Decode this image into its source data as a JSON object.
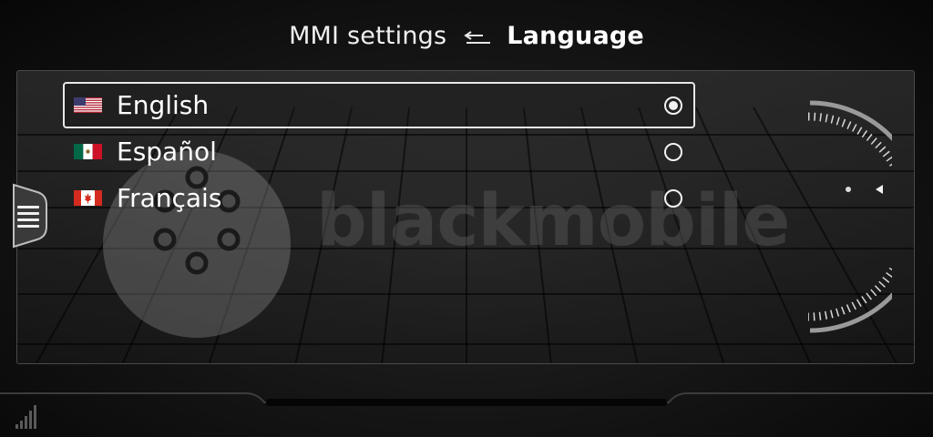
{
  "header": {
    "crumb": "MMI settings",
    "title": "Language",
    "back_icon": "return-arrow-icon"
  },
  "languages": [
    {
      "label": "English",
      "flag": "us-flag-icon",
      "selected": true
    },
    {
      "label": "Español",
      "flag": "mexico-flag-icon",
      "selected": false
    },
    {
      "label": "Français",
      "flag": "canada-flag-icon",
      "selected": false
    }
  ],
  "watermark": {
    "text": "blackmobile"
  },
  "side_menu": {
    "icon": "menu-lines-icon"
  },
  "status": {
    "signal_icon": "signal-bars-icon"
  },
  "colors": {
    "accent": "#f2f2f2",
    "background": "#0b0b0b",
    "panel_border": "#4a4a4a"
  }
}
